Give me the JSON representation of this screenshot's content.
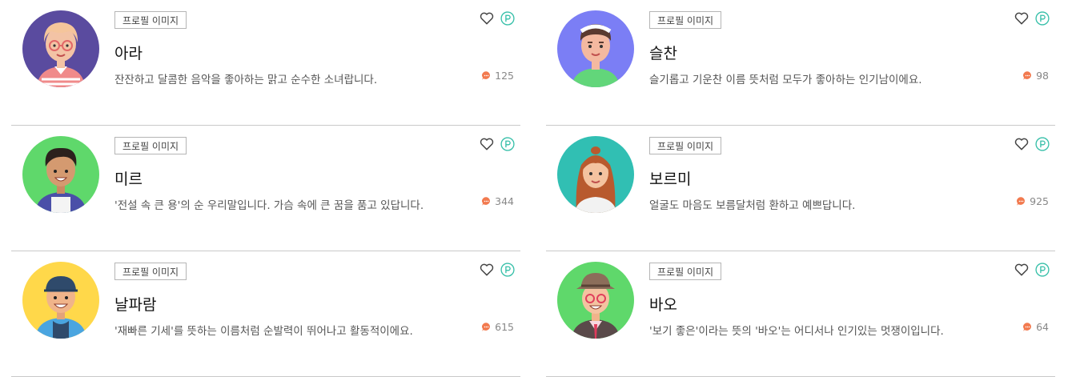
{
  "colors": {
    "point_accent": "#35bfa8",
    "comment_accent": "#f27a4f",
    "divider": "#c9c9c9"
  },
  "cards": [
    {
      "tag": "프로필 이미지",
      "name": "아라",
      "desc": "잔잔하고 달콤한 음악을 좋아하는 맑고 순수한 소녀랍니다.",
      "comments": "125",
      "avatar_bg": "#5a4b9f",
      "avatar": "girl-glasses-avatar"
    },
    {
      "tag": "프로필 이미지",
      "name": "슬찬",
      "desc": "슬기롭고 기운찬 이름 뜻처럼 모두가 좋아하는 인기남이에요.",
      "comments": "98",
      "avatar_bg": "#7b7ef5",
      "avatar": "boy-headband-avatar"
    },
    {
      "tag": "프로필 이미지",
      "name": "미르",
      "desc": "'전설 속 큰 용'의 순 우리말입니다. 가슴 속에 큰 꿈을 품고 있답니다.",
      "comments": "344",
      "avatar_bg": "#5fd86b",
      "avatar": "boy-hoodie-avatar"
    },
    {
      "tag": "프로필 이미지",
      "name": "보르미",
      "desc": "얼굴도 마음도 보름달처럼 환하고 예쁘답니다.",
      "comments": "925",
      "avatar_bg": "#31bfb3",
      "avatar": "girl-longhair-avatar"
    },
    {
      "tag": "프로필 이미지",
      "name": "날파람",
      "desc": "'재빠른 기세'를 뜻하는 이름처럼 순발력이 뛰어나고 활동적이에요.",
      "comments": "615",
      "avatar_bg": "#ffd84a",
      "avatar": "boy-cap-avatar"
    },
    {
      "tag": "프로필 이미지",
      "name": "바오",
      "desc": "'보기 좋은'이라는 뜻의 '바오'는 어디서나 인기있는 멋쟁이입니다.",
      "comments": "64",
      "avatar_bg": "#5fd86b",
      "avatar": "man-hat-avatar"
    }
  ]
}
